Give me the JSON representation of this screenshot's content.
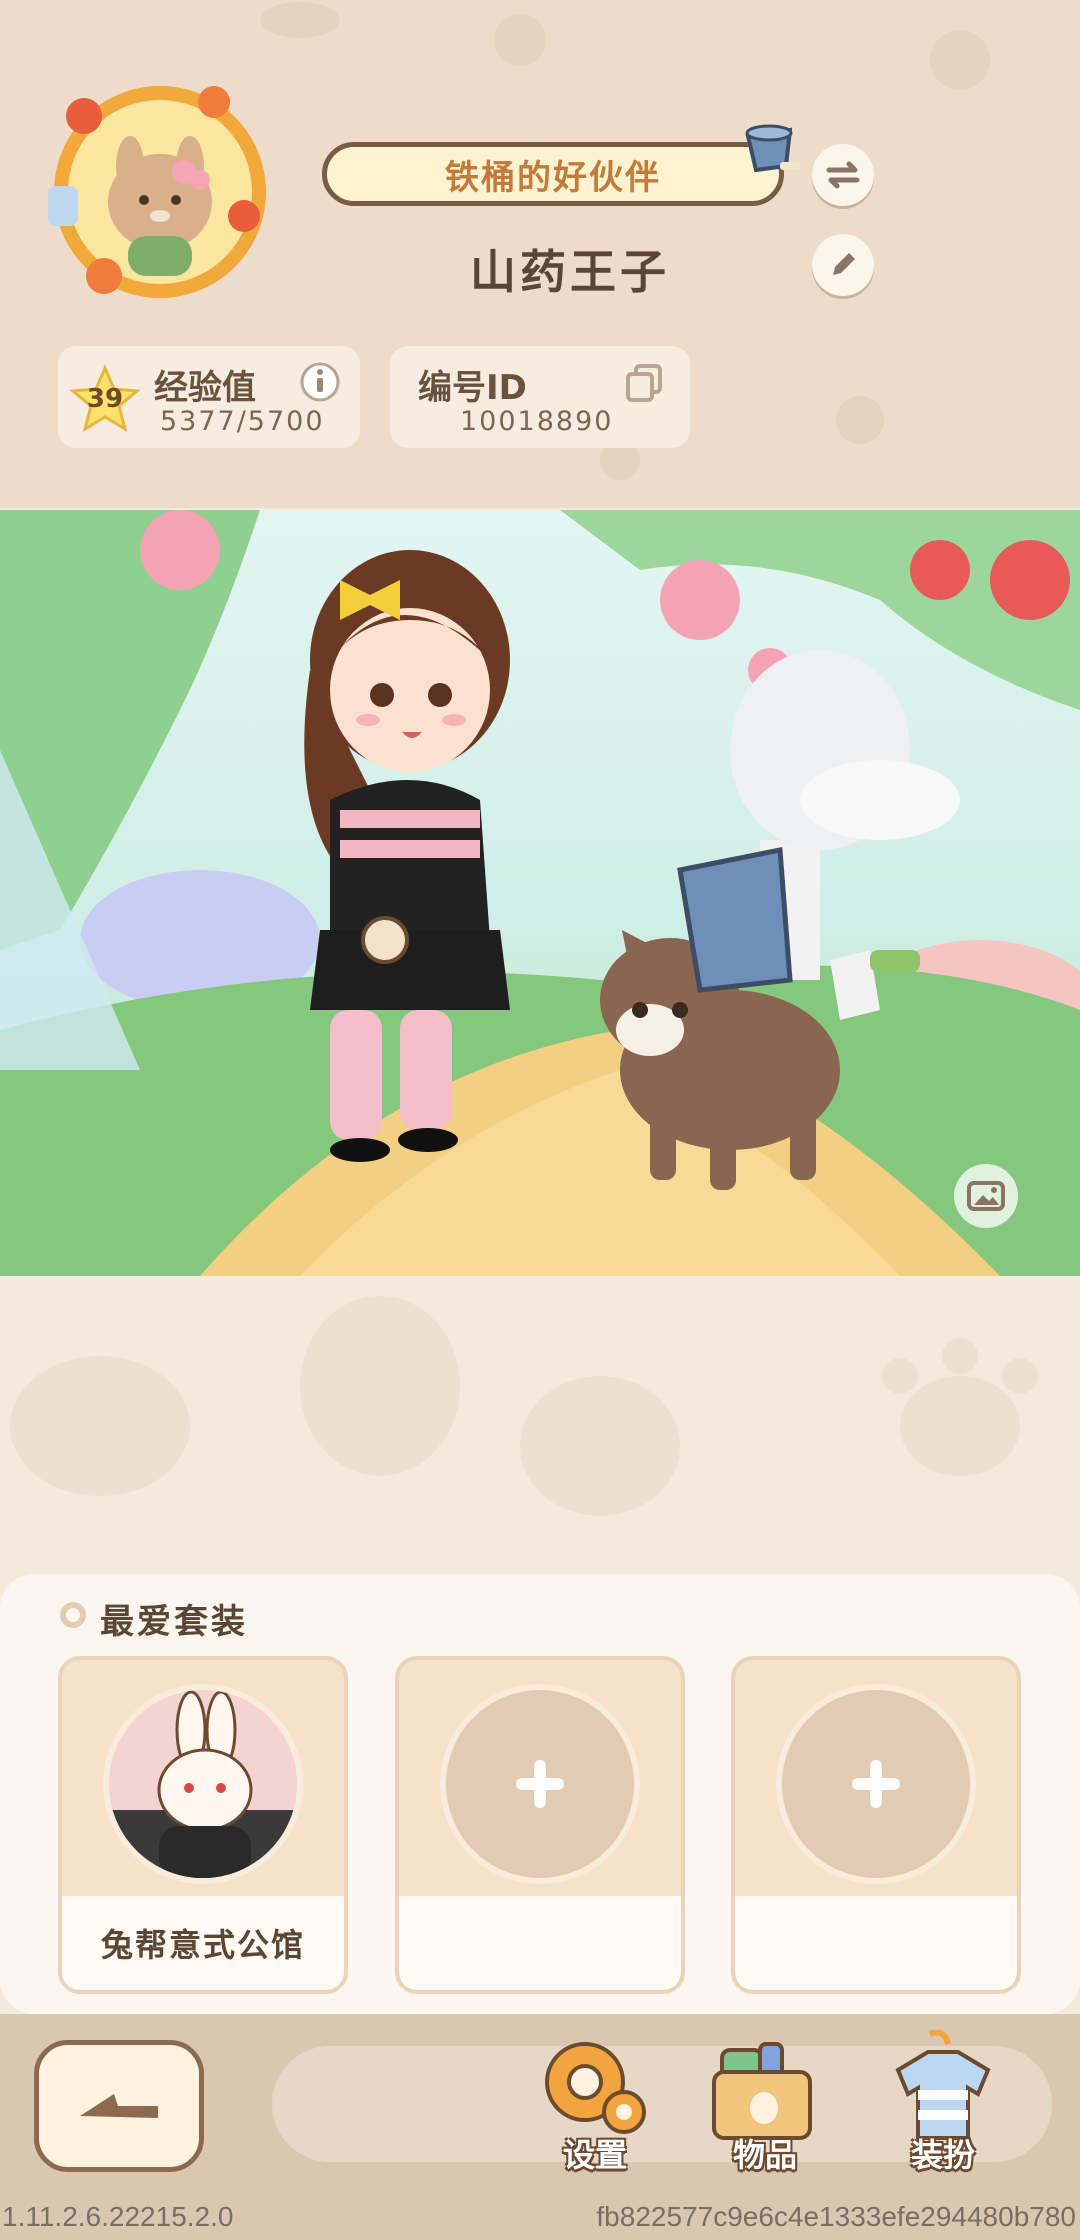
{
  "profile": {
    "title_badge": "铁桶的好伙伴",
    "nickname": "山药王子",
    "exp": {
      "label": "经验值",
      "level": "39",
      "value": "5377/5700"
    },
    "id_card": {
      "label": "编号ID",
      "value": "10018890"
    }
  },
  "favorites": {
    "title": "最爱套装",
    "slots": [
      {
        "label": "兔帮意式公馆",
        "filled": true
      },
      {
        "label": "",
        "filled": false
      },
      {
        "label": "",
        "filled": false
      }
    ]
  },
  "nav": {
    "settings": "设置",
    "items": "物品",
    "dressup": "装扮"
  },
  "footer": {
    "version": "1.11.2.6.22215.2.0",
    "hash": "fb822577c9e6c4e1333efe294480b780"
  },
  "colors": {
    "header_bg": "#ecdcc9",
    "accent_brown": "#5b4636",
    "pill_text": "#c27a3d"
  }
}
